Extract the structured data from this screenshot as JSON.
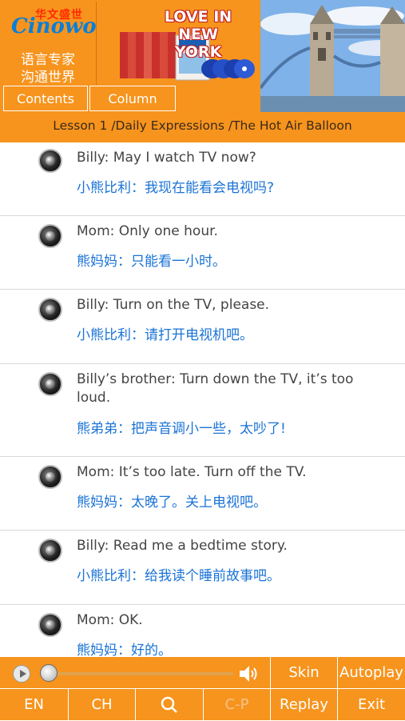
{
  "header": {
    "logo_cn": "华文盛世",
    "logo_word": "Cinowo",
    "tagline_1": "语言专家",
    "tagline_2": "沟通世界",
    "series_title_1": "LOVE IN",
    "series_title_2": "NEW YORK",
    "contents_label": "Contents",
    "column_label": "Column",
    "lesson_title": "Lesson 1 /Daily Expressions /The Hot Air Balloon"
  },
  "dialogues": [
    {
      "en": "Billy: May I watch TV now?",
      "cn": "小熊比利：我现在能看会电视吗?"
    },
    {
      "en": "Mom: Only one hour.",
      "cn": "熊妈妈：只能看一小时。"
    },
    {
      "en": "Billy: Turn on the TV, please.",
      "cn": "小熊比利：请打开电视机吧。"
    },
    {
      "en": "Billy’s brother: Turn down the TV, it’s too loud.",
      "cn": "熊弟弟：把声音调小一些，太吵了!"
    },
    {
      "en": "Mom: It’s too late. Turn off the TV.",
      "cn": "熊妈妈：太晚了。关上电视吧。"
    },
    {
      "en": "Billy: Read me a bedtime story.",
      "cn": "小熊比利：给我读个睡前故事吧。"
    },
    {
      "en": "Mom: OK.",
      "cn": "熊妈妈：好的。"
    }
  ],
  "player": {
    "progress": 0.0
  },
  "bottom": {
    "skin": "Skin",
    "autoplay": "Autoplay",
    "en": "EN",
    "ch": "CH",
    "cp": "C-P",
    "replay": "Replay",
    "exit": "Exit"
  },
  "colors": {
    "accent": "#f7941d",
    "chinese_text": "#1a73d6"
  }
}
